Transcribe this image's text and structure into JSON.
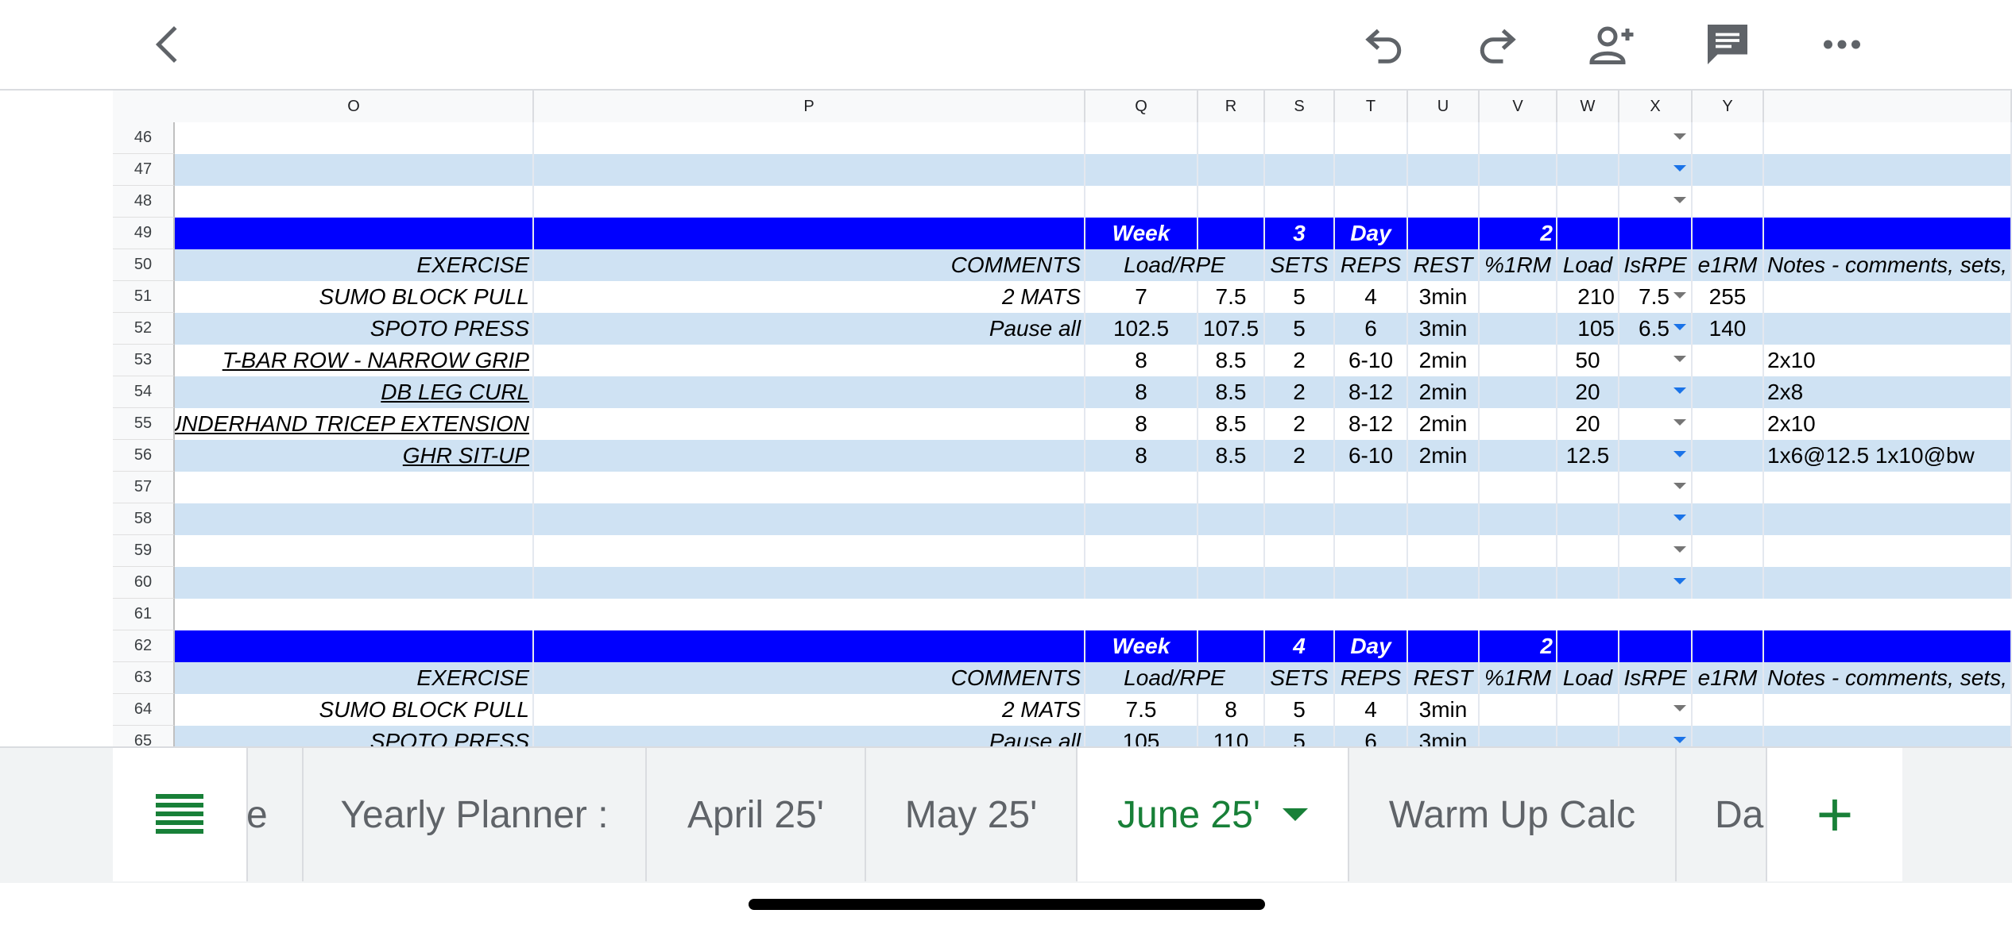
{
  "toolbar": {
    "back_icon": "chevron-left-icon",
    "undo_icon": "undo-icon",
    "redo_icon": "redo-icon",
    "share_icon": "add-person-icon",
    "comments_icon": "comment-icon",
    "more_icon": "more-horizontal-icon"
  },
  "columns": [
    "O",
    "P",
    "Q",
    "R",
    "S",
    "T",
    "U",
    "V",
    "W",
    "X",
    "Y",
    ""
  ],
  "rows": {
    "r46": {
      "num": "46"
    },
    "r47": {
      "num": "47"
    },
    "r48": {
      "num": "48"
    },
    "r49": {
      "num": "49",
      "week": "Week",
      "week_val": "3",
      "day": "Day",
      "day_val": "2"
    },
    "r50": {
      "num": "50",
      "exercise": "EXERCISE",
      "comments": "COMMENTS",
      "load_rpe": "Load/RPE",
      "sets": "SETS",
      "reps": "REPS",
      "rest": "REST",
      "pct": "%1RM",
      "load": "Load",
      "isrpe": "IsRPE",
      "e1rm": "e1RM",
      "notes": "Notes - comments, sets, r"
    },
    "r51": {
      "num": "51",
      "exercise": "SUMO BLOCK PULL",
      "comments": "2 MATS",
      "q": "7",
      "r": "7.5",
      "s": "5",
      "t": "4",
      "u": "3min",
      "w": "210",
      "x": "7.5",
      "y": "255",
      "notes": ""
    },
    "r52": {
      "num": "52",
      "exercise": "SPOTO PRESS",
      "comments": "Pause all",
      "q": "102.5",
      "r": "107.5",
      "s": "5",
      "t": "6",
      "u": "3min",
      "w": "105",
      "x": "6.5",
      "y": "140",
      "notes": ""
    },
    "r53": {
      "num": "53",
      "exercise": "T-BAR ROW - NARROW GRIP",
      "comments": "",
      "q": "8",
      "r": "8.5",
      "s": "2",
      "t": "6-10",
      "u": "2min",
      "w": "50",
      "x": "",
      "y": "",
      "notes": "2x10"
    },
    "r54": {
      "num": "54",
      "exercise": "DB LEG CURL",
      "comments": "",
      "q": "8",
      "r": "8.5",
      "s": "2",
      "t": "8-12",
      "u": "2min",
      "w": "20",
      "x": "",
      "y": "",
      "notes": "2x8"
    },
    "r55": {
      "num": "55",
      "exercise": "UNDERHAND TRICEP EXTENSION",
      "comments": "",
      "q": "8",
      "r": "8.5",
      "s": "2",
      "t": "8-12",
      "u": "2min",
      "w": "20",
      "x": "",
      "y": "",
      "notes": "2x10"
    },
    "r56": {
      "num": "56",
      "exercise": "GHR SIT-UP",
      "comments": "",
      "q": "8",
      "r": "8.5",
      "s": "2",
      "t": "6-10",
      "u": "2min",
      "w": "12.5",
      "x": "",
      "y": "",
      "notes": "1x6@12.5 1x10@bw"
    },
    "r57": {
      "num": "57"
    },
    "r58": {
      "num": "58"
    },
    "r59": {
      "num": "59"
    },
    "r60": {
      "num": "60"
    },
    "r61": {
      "num": "61"
    },
    "r62": {
      "num": "62",
      "week": "Week",
      "week_val": "4",
      "day": "Day",
      "day_val": "2"
    },
    "r63": {
      "num": "63",
      "exercise": "EXERCISE",
      "comments": "COMMENTS",
      "load_rpe": "Load/RPE",
      "sets": "SETS",
      "reps": "REPS",
      "rest": "REST",
      "pct": "%1RM",
      "load": "Load",
      "isrpe": "IsRPE",
      "e1rm": "e1RM",
      "notes": "Notes - comments, sets, r"
    },
    "r64": {
      "num": "64",
      "exercise": "SUMO BLOCK PULL",
      "comments": "2 MATS",
      "q": "7.5",
      "r": "8",
      "s": "5",
      "t": "4",
      "u": "3min"
    },
    "r65": {
      "num": "65",
      "exercise": "SPOTO PRESS",
      "comments": "Pause all",
      "q": "105",
      "r": "110",
      "s": "5",
      "t": "6",
      "u": "3min"
    }
  },
  "tabs": {
    "menu_icon": "list-menu-icon",
    "partial_left": "e",
    "yearly": "Yearly Planner :",
    "april": "April 25'",
    "may": "May 25'",
    "june": "June 25'",
    "warmup": "Warm Up Calc",
    "partial_right": "Dai",
    "add": "+"
  },
  "colors": {
    "header_blue": "#0000ff",
    "band_blue": "#cfe2f3",
    "accent_green": "#188038"
  }
}
